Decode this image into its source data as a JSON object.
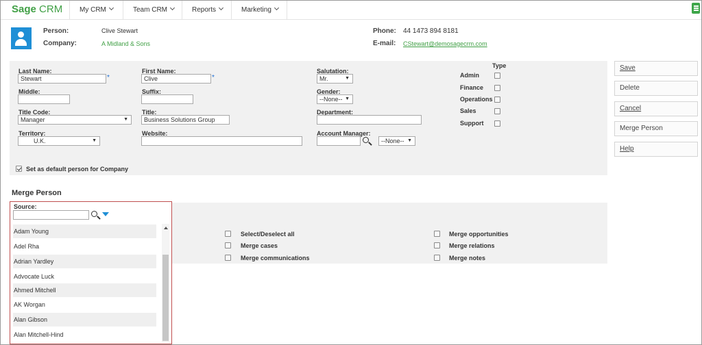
{
  "app": {
    "logo_brand": "Sage",
    "logo_product": "CRM"
  },
  "nav": {
    "items": [
      "My CRM",
      "Team CRM",
      "Reports",
      "Marketing"
    ]
  },
  "header": {
    "person_label": "Person:",
    "person_value": "Clive Stewart",
    "company_label": "Company:",
    "company_value": "A Midland & Sons",
    "phone_label": "Phone:",
    "phone_value": "44 1473 894 8181",
    "email_label": "E-mail:",
    "email_value": "CStewart@demosagecrm.com"
  },
  "form": {
    "last_name_label": "Last Name:",
    "last_name_value": "Stewart",
    "first_name_label": "First Name:",
    "first_name_value": "Clive",
    "salutation_label": "Salutation:",
    "salutation_value": "Mr.",
    "middle_label": "Middle:",
    "middle_value": "",
    "suffix_label": "Suffix:",
    "suffix_value": "",
    "gender_label": "Gender:",
    "gender_value": "--None--",
    "title_code_label": "Title Code:",
    "title_code_value": "Manager",
    "title_label": "Title:",
    "title_value": "Business Solutions Group",
    "department_label": "Department:",
    "department_value": "",
    "territory_label": "Territory:",
    "territory_value": "U.K.",
    "website_label": "Website:",
    "website_value": "",
    "account_manager_label": "Account Manager:",
    "account_manager_value": "",
    "account_manager_select": "--None--",
    "default_person_label": "Set as default person for Company",
    "default_person_checked": true
  },
  "type": {
    "header": "Type",
    "options": [
      {
        "label": "Admin",
        "checked": false
      },
      {
        "label": "Finance",
        "checked": false
      },
      {
        "label": "Operations",
        "checked": false
      },
      {
        "label": "Sales",
        "checked": false
      },
      {
        "label": "Support",
        "checked": false
      }
    ]
  },
  "actions": {
    "save": "Save",
    "delete": "Delete",
    "cancel": "Cancel",
    "merge_person": "Merge Person",
    "help": "Help"
  },
  "merge": {
    "title": "Merge Person",
    "source_label": "Source:",
    "source_value": "",
    "list": [
      "Adam Young",
      "Adel Rha",
      "Adrian Yardley",
      "Advocate Luck",
      "Ahmed Mitchell",
      "AK Worgan",
      "Alan Gibson",
      "Alan Mitchell-Hind"
    ],
    "options_left": [
      "Select/Deselect all",
      "Merge cases",
      "Merge communications"
    ],
    "options_right": [
      "Merge opportunities",
      "Merge relations",
      "Merge notes"
    ]
  },
  "colors": {
    "brand_green": "#41a046",
    "avatar_blue": "#1f8fd6",
    "source_border": "#c04f4f"
  }
}
